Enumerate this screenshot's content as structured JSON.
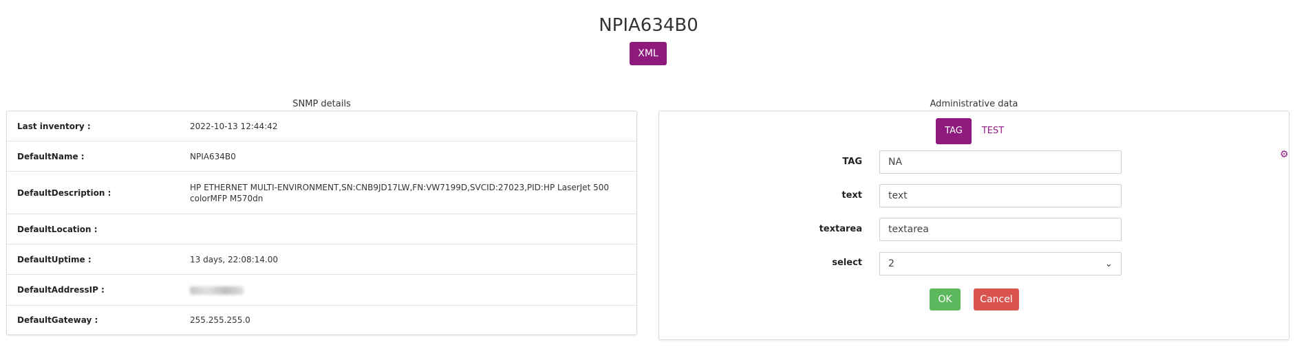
{
  "header": {
    "title": "NPIA634B0",
    "xml_button": "XML"
  },
  "snmp": {
    "section_title": "SNMP details",
    "rows": [
      {
        "label": "Last inventory :",
        "value": "2022-10-13 12:44:42"
      },
      {
        "label": "DefaultName :",
        "value": "NPIA634B0"
      },
      {
        "label": "DefaultDescription :",
        "value": "HP ETHERNET MULTI-ENVIRONMENT,SN:CNB9JD17LW,FN:VW7199D,SVCID:27023,PID:HP LaserJet 500 colorMFP M570dn"
      },
      {
        "label": "DefaultLocation :",
        "value": ""
      },
      {
        "label": "DefaultUptime :",
        "value": "13 days, 22:08:14.00"
      },
      {
        "label": "DefaultAddressIP :",
        "value": ""
      },
      {
        "label": "DefaultGateway :",
        "value": "255.255.255.0"
      }
    ]
  },
  "admin": {
    "section_title": "Administrative data",
    "tabs": [
      {
        "label": "TAG",
        "active": true
      },
      {
        "label": "TEST",
        "active": false
      }
    ],
    "fields": {
      "tag": {
        "label": "TAG",
        "value": "NA"
      },
      "text": {
        "label": "text",
        "value": "text"
      },
      "textarea": {
        "label": "textarea",
        "value": "textarea"
      },
      "select": {
        "label": "select",
        "value": "2"
      }
    },
    "ok_button": "OK",
    "cancel_button": "Cancel",
    "gear_icon": "gear-icon"
  },
  "colors": {
    "accent": "#8e1a7e",
    "ok": "#5cb85c",
    "cancel": "#d9534f"
  }
}
